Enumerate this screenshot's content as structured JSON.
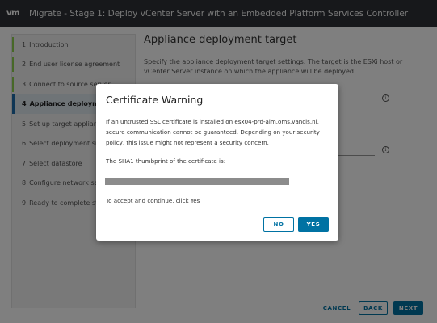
{
  "window": {
    "logo": "vm",
    "title": "Migrate - Stage 1: Deploy vCenter Server with an Embedded Platform Services Controller"
  },
  "sidebar": {
    "steps": [
      {
        "num": "1",
        "label": "Introduction"
      },
      {
        "num": "2",
        "label": "End user license agreement"
      },
      {
        "num": "3",
        "label": "Connect to source server"
      },
      {
        "num": "4",
        "label": "Appliance deployment target"
      },
      {
        "num": "5",
        "label": "Set up target appliance VM"
      },
      {
        "num": "6",
        "label": "Select deployment size"
      },
      {
        "num": "7",
        "label": "Select datastore"
      },
      {
        "num": "8",
        "label": "Configure network settings"
      },
      {
        "num": "9",
        "label": "Ready to complete stage 1"
      }
    ]
  },
  "main": {
    "heading": "Appliance deployment target",
    "description": "Specify the appliance deployment target settings. The target is the ESXi host or vCenter Server instance on which the appliance will be deployed."
  },
  "footer": {
    "cancel_label": "CANCEL",
    "back_label": "BACK",
    "next_label": "NEXT"
  },
  "dialog": {
    "title": "Certificate Warning",
    "message": "If an untrusted SSL certificate is installed on esx04-prd-alm.oms.vancis.nl, secure communication cannot be guaranteed. Depending on your security policy, this issue might not represent a security concern.",
    "thumbprint_label": "The SHA1 thumbprint of the certificate is:",
    "accept_text": "To accept and continue, click Yes",
    "no_label": "NO",
    "yes_label": "YES"
  },
  "colors": {
    "accent": "#0072a3",
    "titlebar": "#2f3136",
    "done_marker": "#8fd14f"
  }
}
